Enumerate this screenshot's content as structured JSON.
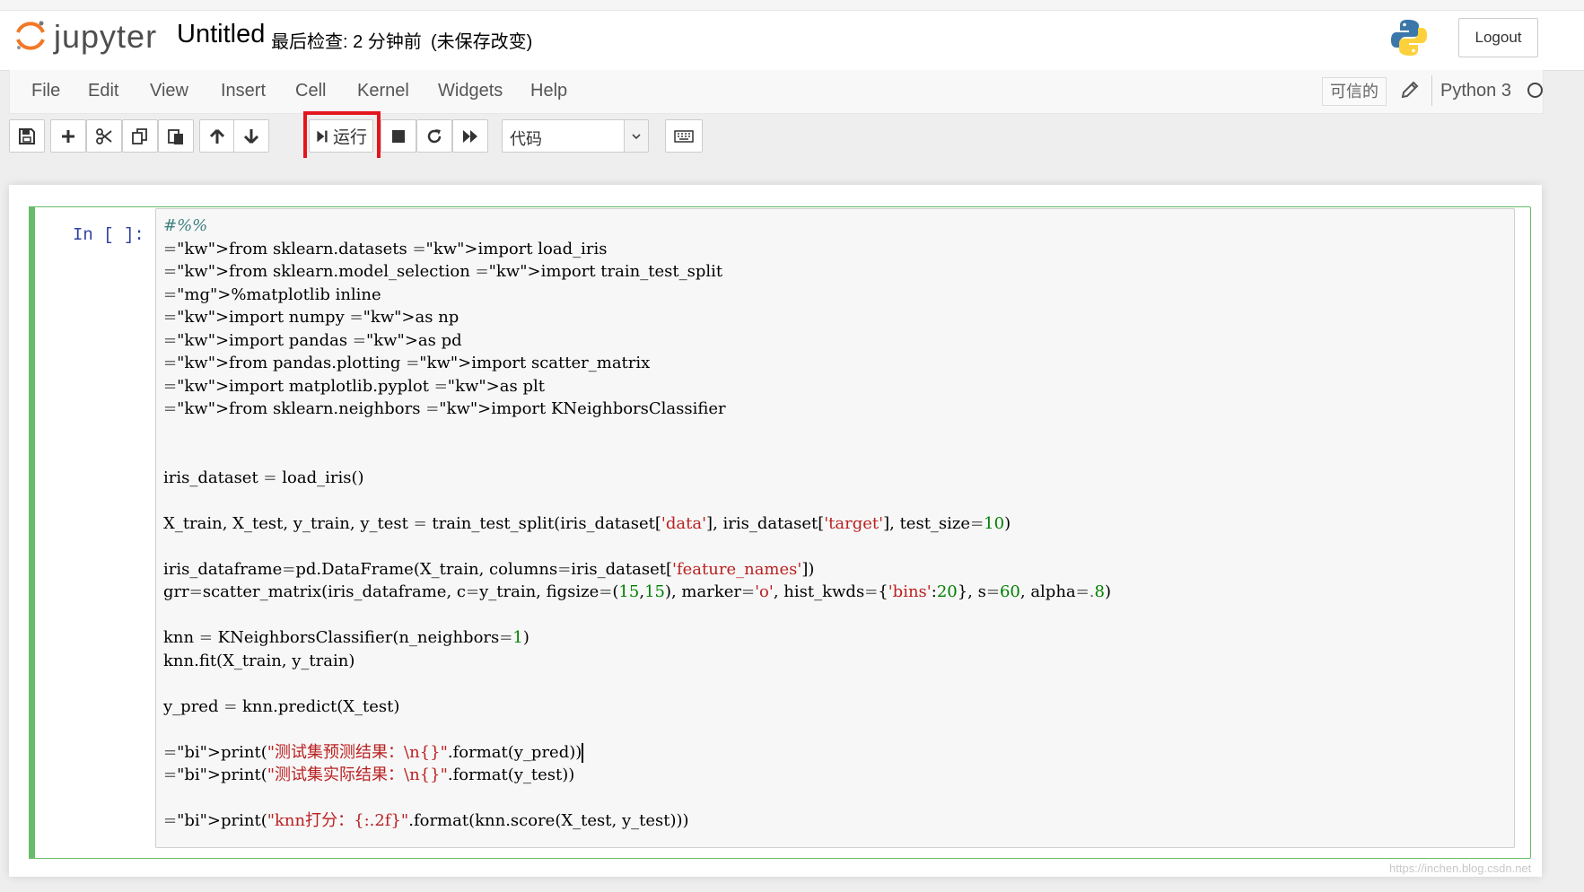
{
  "header": {
    "logo_text": "jupyter",
    "notebook_title": "Untitled",
    "checkpoint": "最后检查: 2 分钟前",
    "unsaved": "(未保存改变)",
    "logout_label": "Logout"
  },
  "menubar": {
    "items": [
      "File",
      "Edit",
      "View",
      "Insert",
      "Cell",
      "Kernel",
      "Widgets",
      "Help"
    ],
    "trusted_label": "可信的",
    "kernel_name": "Python 3"
  },
  "toolbar": {
    "run_label": "运行",
    "cell_type": "代码"
  },
  "cell": {
    "prompt": "In  [  ]:",
    "code_lines": [
      "#%%",
      "from sklearn.datasets import load_iris",
      "from sklearn.model_selection import train_test_split",
      "%matplotlib inline",
      "import numpy as np",
      "import pandas as pd",
      "from pandas.plotting import scatter_matrix",
      "import matplotlib.pyplot as plt",
      "from sklearn.neighbors import KNeighborsClassifier",
      "",
      "",
      "iris_dataset = load_iris()",
      "",
      "X_train, X_test, y_train, y_test = train_test_split(iris_dataset['data'], iris_dataset['target'], test_size=10)",
      "",
      "iris_dataframe=pd.DataFrame(X_train, columns=iris_dataset['feature_names'])",
      "grr=scatter_matrix(iris_dataframe, c=y_train, figsize=(15,15), marker='o', hist_kwds={'bins':20}, s=60, alpha=.8)",
      "",
      "knn = KNeighborsClassifier(n_neighbors=1)",
      "knn.fit(X_train, y_train)",
      "",
      "y_pred = knn.predict(X_test)",
      "",
      "print(\"测试集预测结果：\\n{}\".format(y_pred))",
      "print(\"测试集实际结果：\\n{}\".format(y_test))",
      "",
      "print(\"knn打分：{:.2f}\".format(knn.score(X_test, y_test)))"
    ]
  },
  "watermark": "https://inchen.blog.csdn.net",
  "colors": {
    "run_highlight": "#e3161d",
    "cell_border": "#66bb6a",
    "keyword": "#008000",
    "string": "#ba2121"
  }
}
